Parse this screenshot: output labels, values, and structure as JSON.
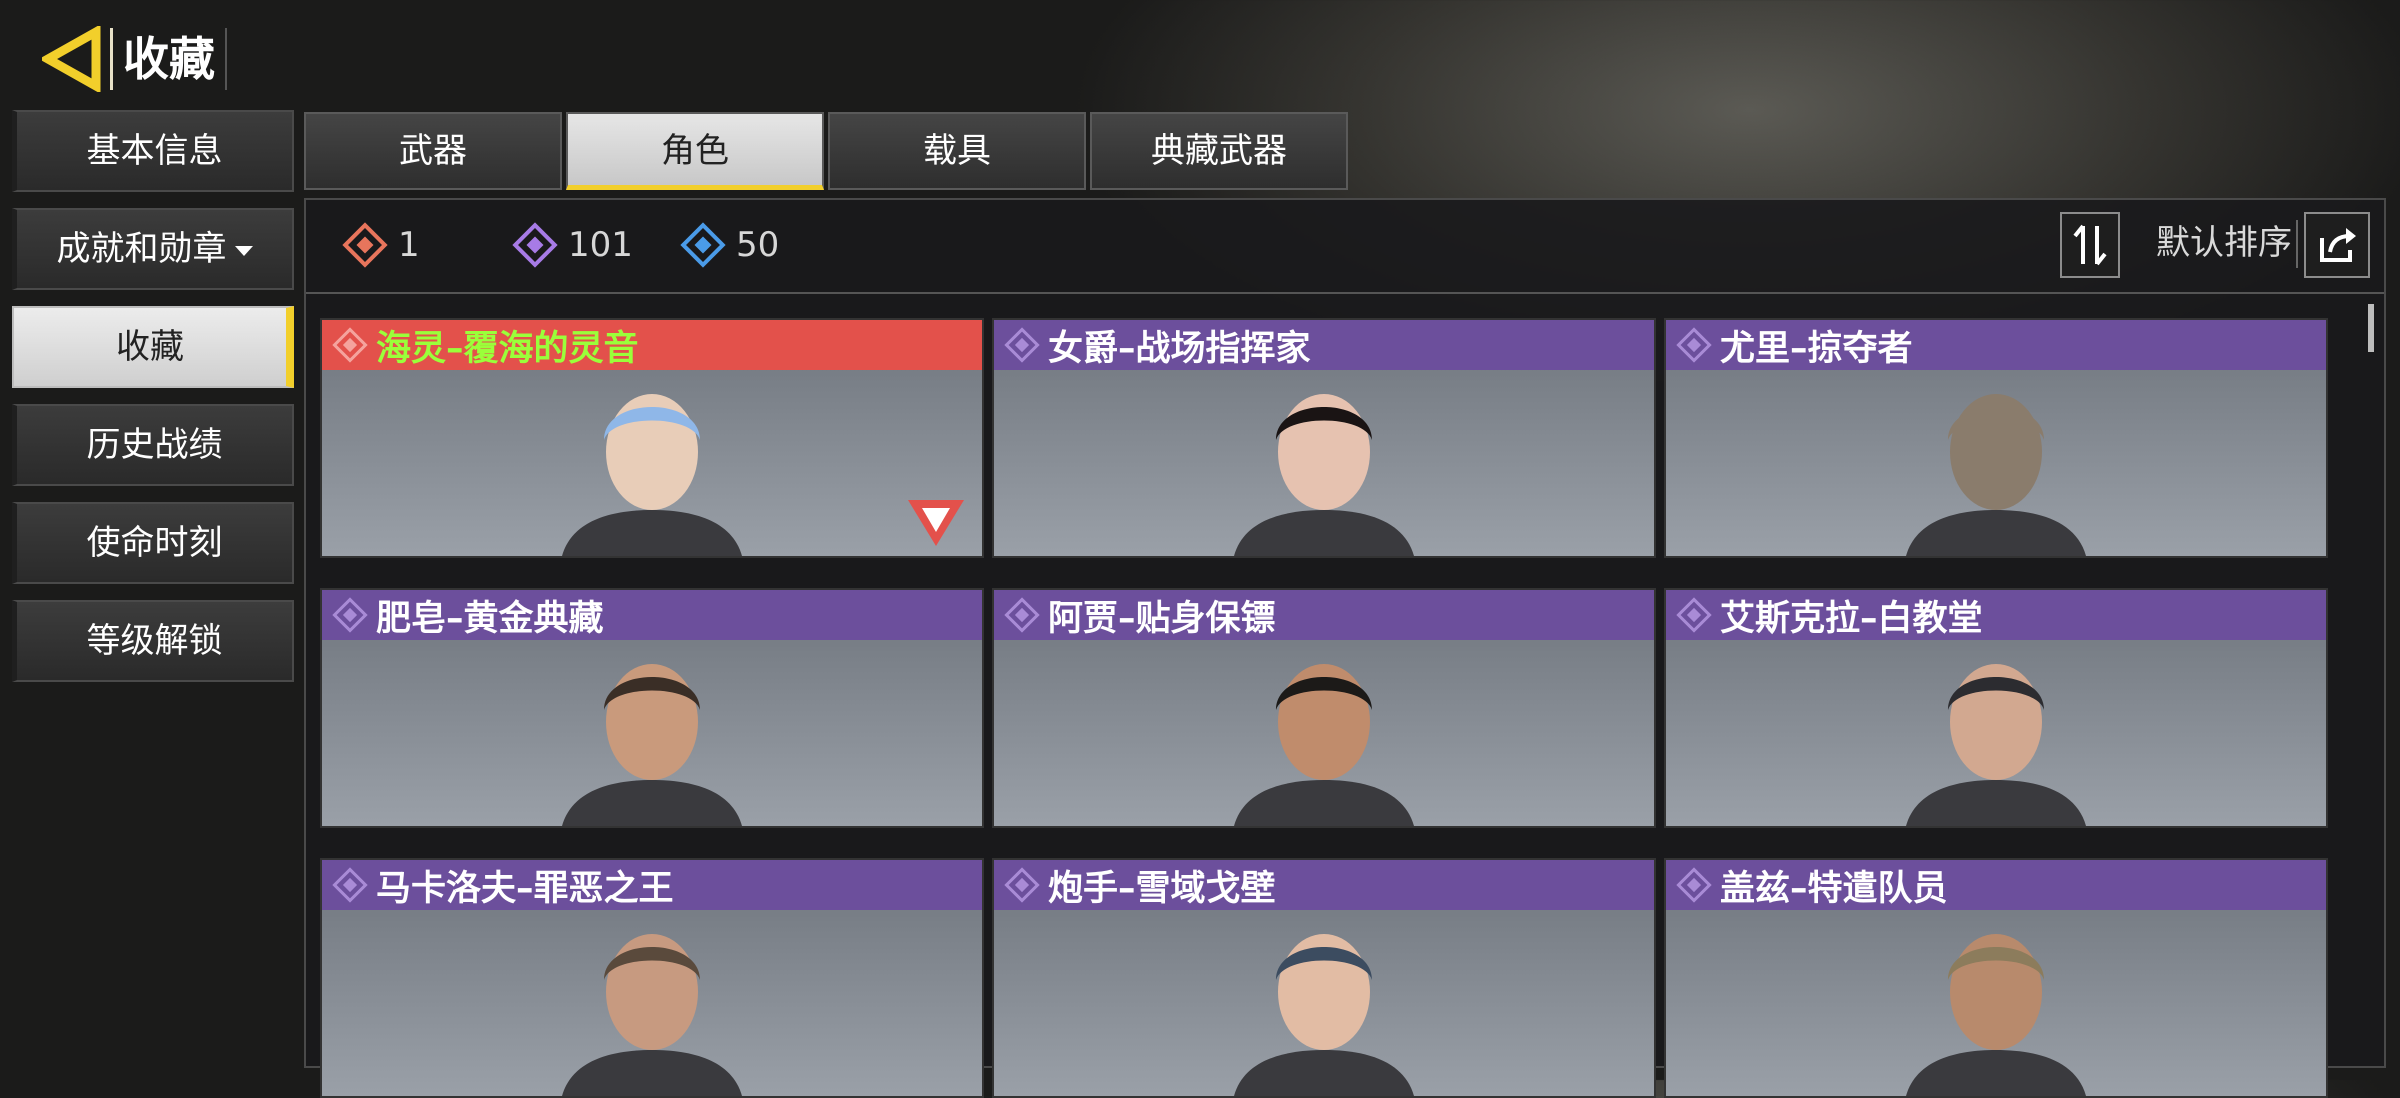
{
  "header": {
    "title": "收藏"
  },
  "sidebar": {
    "items": [
      {
        "label": "基本信息"
      },
      {
        "label": "成就和勋章"
      },
      {
        "label": "收藏"
      },
      {
        "label": "历史战绩"
      },
      {
        "label": "使命时刻"
      },
      {
        "label": "等级解锁"
      }
    ]
  },
  "tabs": [
    {
      "label": "武器"
    },
    {
      "label": "角色"
    },
    {
      "label": "载具"
    },
    {
      "label": "典藏武器"
    }
  ],
  "counts": [
    {
      "value": "1",
      "icon": "red-rarity-icon"
    },
    {
      "value": "101",
      "icon": "purple-rarity-icon"
    },
    {
      "value": "50",
      "icon": "blue-rarity-icon"
    }
  ],
  "sort": {
    "label": "默认排序"
  },
  "characters": [
    {
      "name": "海灵–覆海的灵音",
      "rarity": "red",
      "hair": "#8fb7e8",
      "skin": "#e8cdb8"
    },
    {
      "name": "女爵–战场指挥家",
      "rarity": "purple",
      "hair": "#1a1414",
      "skin": "#e6c2b0"
    },
    {
      "name": "尤里–掠夺者",
      "rarity": "purple",
      "hair": "#8a7c6c",
      "skin": "#8a7c6c"
    },
    {
      "name": "肥皂–黄金典藏",
      "rarity": "purple",
      "hair": "#3a2e26",
      "skin": "#c99a7c"
    },
    {
      "name": "阿贾–贴身保镖",
      "rarity": "purple",
      "hair": "#1c1a18",
      "skin": "#c08c6c"
    },
    {
      "name": "艾斯克拉–白教堂",
      "rarity": "purple",
      "hair": "#2c2c30",
      "skin": "#d2a890"
    },
    {
      "name": "马卡洛夫–罪恶之王",
      "rarity": "purple",
      "hair": "#5a4a3c",
      "skin": "#c79a80"
    },
    {
      "name": "炮手–雪域戈壁",
      "rarity": "purple",
      "hair": "#3c4c60",
      "skin": "#e2bca4"
    },
    {
      "name": "盖兹–特遣队员",
      "rarity": "purple",
      "hair": "#8c7c5c",
      "skin": "#b88a6c"
    }
  ],
  "colors": {
    "accent": "#f2cf2b",
    "purple": "#6c4f9c",
    "red": "#e3514b"
  }
}
